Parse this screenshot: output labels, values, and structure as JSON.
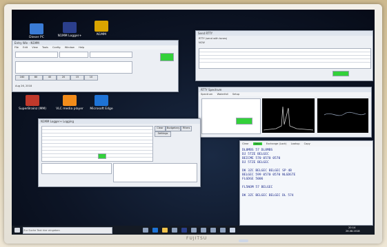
{
  "desktop": {
    "icons": [
      {
        "label": "Dieser PC",
        "color": "#3a7bd5"
      },
      {
        "label": "N1MM Logger+",
        "color": "#2b3f8c"
      },
      {
        "label": "N1MM",
        "color": "#d9a400"
      },
      {
        "label": "SuperBrainz (MM)",
        "color": "#c0392b"
      },
      {
        "label": "VLC media player",
        "color": "#f28c1a"
      },
      {
        "label": "Microsoft Edge",
        "color": "#1e73d6"
      }
    ]
  },
  "entry_window": {
    "title": "Entry Win - N1MM",
    "menu": [
      "File",
      "Edit",
      "View",
      "Tools",
      "Config",
      "Window",
      "Help"
    ],
    "band_buttons": [
      "160",
      "80",
      "40",
      "20",
      "15",
      "10"
    ],
    "status": "Aug 26, 2018"
  },
  "logging_window": {
    "title": "N1MM Logger+ Logging",
    "buttons": [
      "Clear",
      "Budgetary",
      "Filters",
      "Settings"
    ]
  },
  "sendrtty": {
    "title": "Send RTTY",
    "checkboxes": [
      "RTTY (send with tones)",
      "NCW"
    ]
  },
  "spectrum": {
    "title": "RTTY Spectrum",
    "tabs": [
      "Spectrum",
      "Waterfall",
      "Setup"
    ]
  },
  "message_log": {
    "tab_clear": "Clear",
    "tab_active": "Send",
    "tab_opts": [
      "Exchange (Lock)",
      "Lookup",
      "Copy"
    ],
    "lines": [
      "DL8MBS 57 DL8MBS",
      "DJ 5TZE BELGEC",
      "BEICME 570 0570 0570",
      "DJ 5TZE BELGEC",
      "",
      "DK 3ZC BELGEC BELGEC SP 4B",
      "BELGEC 599 0570 0570 NLGDGTE",
      "FLGDGE 5006",
      "",
      "FL5NOM 57 BELGEC",
      "",
      "DK 3ZC BELGEC BELGEC DL 574"
    ]
  },
  "taskbar": {
    "search_placeholder": "Zur Suche Text hier eingeben",
    "time": "20:14",
    "date": "26.08.2018"
  },
  "monitor": {
    "brand": "FUJITSU"
  }
}
